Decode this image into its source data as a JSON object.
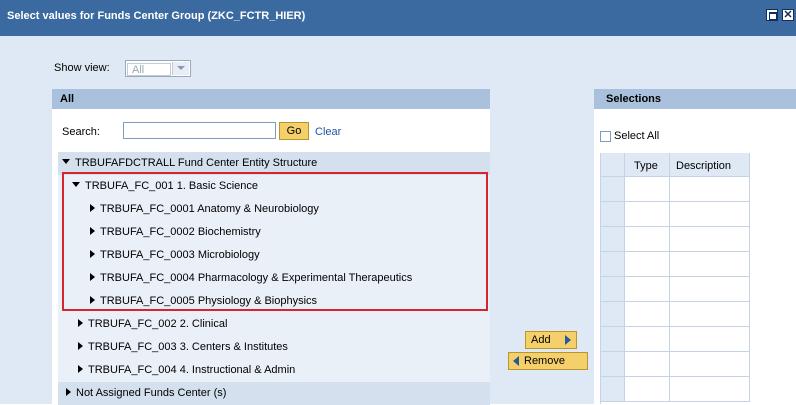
{
  "window": {
    "title": "Select values for Funds Center Group (ZKC_FCTR_HIER)"
  },
  "show_view": {
    "label": "Show view:",
    "selected": "All"
  },
  "left_panel": {
    "header": "All",
    "search_label": "Search:",
    "search_value": "",
    "go_label": "Go",
    "clear_label": "Clear"
  },
  "tree": {
    "root": "TRBUFAFDCTRALL Fund Center Entity Structure",
    "items": [
      {
        "label": "TRBUFA_FC_001 1.  Basic Science",
        "state": "expanded"
      },
      {
        "label": "TRBUFA_FC_0001 Anatomy & Neurobiology",
        "state": "collapsed"
      },
      {
        "label": "TRBUFA_FC_0002 Biochemistry",
        "state": "collapsed"
      },
      {
        "label": "TRBUFA_FC_0003 Microbiology",
        "state": "collapsed"
      },
      {
        "label": "TRBUFA_FC_0004 Pharmacology & Experimental Therapeutics",
        "state": "collapsed"
      },
      {
        "label": "TRBUFA_FC_0005 Physiology & Biophysics",
        "state": "collapsed"
      },
      {
        "label": "TRBUFA_FC_002 2.  Clinical",
        "state": "collapsed"
      },
      {
        "label": "TRBUFA_FC_003 3.  Centers & Institutes",
        "state": "collapsed"
      },
      {
        "label": "TRBUFA_FC_004 4.  Instructional & Admin",
        "state": "collapsed"
      }
    ],
    "unassigned": "Not Assigned Funds Center (s)"
  },
  "actions": {
    "add_label": "Add",
    "remove_label": "Remove"
  },
  "right_panel": {
    "header": "Selections",
    "select_all_label": "Select All",
    "columns": [
      "Type",
      "Description"
    ]
  },
  "colors": {
    "title_bar": "#3b6aa0",
    "panel_header": "#a9c1dd",
    "button": "#f5d06a",
    "highlight_box": "#d6262b",
    "link": "#1f56a8"
  }
}
